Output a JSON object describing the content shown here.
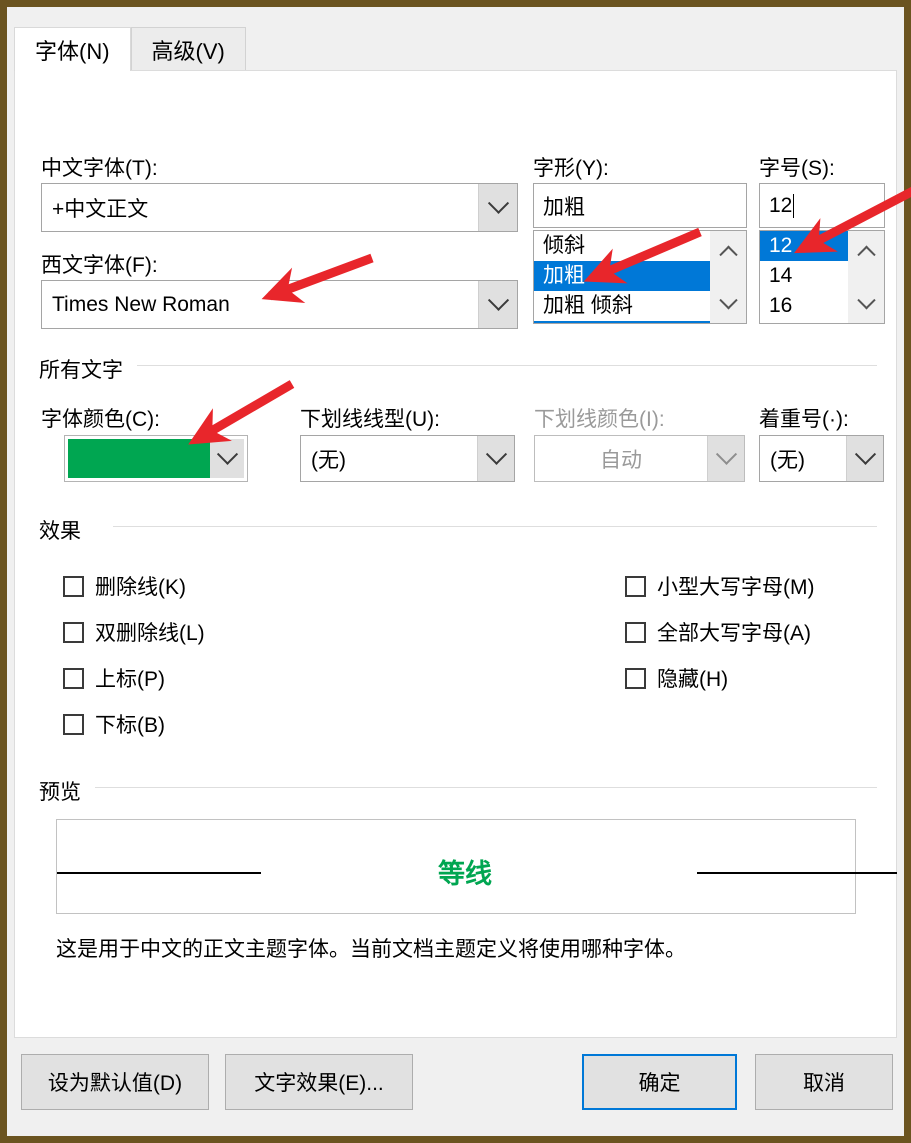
{
  "window": {
    "frame_color": "#6b5420",
    "dialog_bg": "#f0f0f0"
  },
  "tabs": [
    {
      "label": "字体(N)",
      "active": true
    },
    {
      "label": "高级(V)",
      "active": false
    }
  ],
  "fields": {
    "chinese_font": {
      "label": "中文字体(T):",
      "value": "+中文正文"
    },
    "western_font": {
      "label": "西文字体(F):",
      "value": "Times New Roman"
    },
    "font_style": {
      "label": "字形(Y):",
      "value": "加粗",
      "options": [
        "倾斜",
        "加粗",
        "加粗 倾斜"
      ],
      "selected_index": 1
    },
    "font_size": {
      "label": "字号(S):",
      "value": "12",
      "options": [
        "12",
        "14",
        "16"
      ],
      "selected_index": 0
    }
  },
  "all_text_group": {
    "title": "所有文字",
    "font_color": {
      "label": "字体颜色(C):",
      "value_color": "#00a651"
    },
    "underline_style": {
      "label": "下划线线型(U):",
      "value": "(无)"
    },
    "underline_color": {
      "label": "下划线颜色(I):",
      "value": "自动",
      "disabled": true
    },
    "emphasis_mark": {
      "label": "着重号(·):",
      "value": "(无)"
    }
  },
  "effects_group": {
    "title": "效果",
    "left_column": [
      {
        "label": "删除线(K)",
        "checked": false
      },
      {
        "label": "双删除线(L)",
        "checked": false
      },
      {
        "label": "上标(P)",
        "checked": false
      },
      {
        "label": "下标(B)",
        "checked": false
      }
    ],
    "right_column": [
      {
        "label": "小型大写字母(M)",
        "checked": false
      },
      {
        "label": "全部大写字母(A)",
        "checked": false
      },
      {
        "label": "隐藏(H)",
        "checked": false
      }
    ]
  },
  "preview_group": {
    "title": "预览",
    "sample_text": "等线",
    "sample_color": "#00a651",
    "description": "这是用于中文的正文主题字体。当前文档主题定义将使用哪种字体。"
  },
  "footer": {
    "set_default": "设为默认值(D)",
    "text_effects": "文字效果(E)...",
    "ok": "确定",
    "cancel": "取消"
  },
  "annotations": {
    "arrow_color": "#e8262b",
    "count": 4
  }
}
